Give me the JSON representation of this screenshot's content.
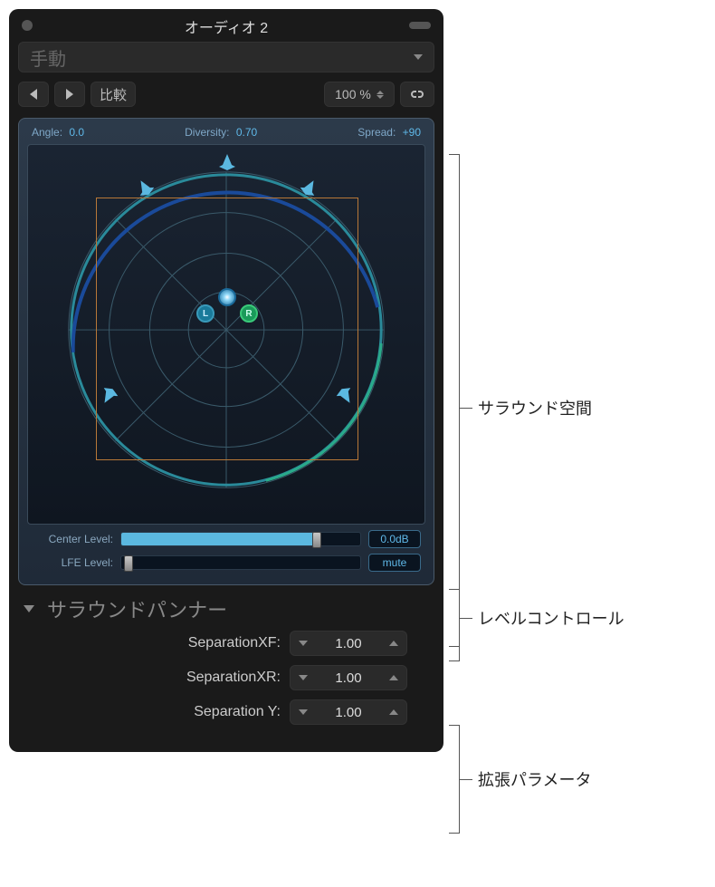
{
  "window": {
    "title": "オーディオ 2"
  },
  "preset": {
    "placeholder": "手動"
  },
  "toolbar": {
    "compare": "比較",
    "zoom": "100 %"
  },
  "panner": {
    "angle_label": "Angle:",
    "angle_value": "0.0",
    "diversity_label": "Diversity:",
    "diversity_value": "0.70",
    "spread_label": "Spread:",
    "spread_value": "+90",
    "puck_l": "L",
    "puck_r": "R"
  },
  "levels": {
    "center_label": "Center Level:",
    "center_value": "0.0dB",
    "center_fill_pct": 82,
    "lfe_label": "LFE Level:",
    "lfe_value": "mute",
    "lfe_fill_pct": 0,
    "lfe_handle_pct": 3
  },
  "section": {
    "title": "サラウンドパンナー"
  },
  "params": [
    {
      "label": "SeparationXF:",
      "value": "1.00"
    },
    {
      "label": "SeparationXR:",
      "value": "1.00"
    },
    {
      "label": "Separation Y:",
      "value": "1.00"
    }
  ],
  "annotations": {
    "field": "サラウンド空間",
    "levels": "レベルコントロール",
    "extended": "拡張パラメータ"
  }
}
